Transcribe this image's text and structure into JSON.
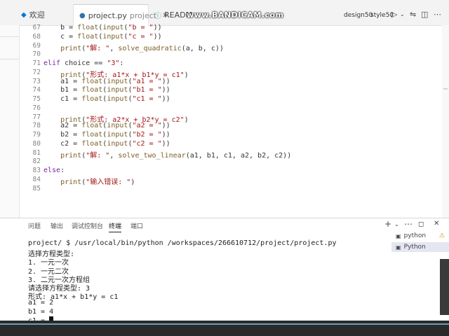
{
  "tabs": [
    {
      "label": "欢迎",
      "desc": "",
      "icon": "vscode-icon"
    },
    {
      "label": "project.py",
      "desc": "project",
      "icon": "python-file-icon"
    },
    {
      "label": "READM",
      "desc": "",
      "icon": "info-icon"
    }
  ],
  "watermark": "www.BANDICAM.com",
  "right_status": {
    "a": "design50",
    "b": "style50"
  },
  "editor": {
    "line_numbers": [
      "67",
      "68",
      "69",
      "70",
      "71",
      "72",
      "73",
      "74",
      "75",
      "76",
      "77",
      "78",
      "79",
      "80",
      "81",
      "82",
      "83",
      "84",
      "85"
    ],
    "lines": [
      "    b = float(input(\"b = \"))",
      "    c = float(input(\"c = \"))",
      "    print(\"解: \", solve_quadratic(a, b, c))",
      "",
      "elif choice == \"3\":",
      "    print(\"形式: a1*x + b1*y = c1\")",
      "    a1 = float(input(\"a1 = \"))",
      "    b1 = float(input(\"b1 = \"))",
      "    c1 = float(input(\"c1 = \"))",
      "",
      "    print(\"形式: a2*x + b2*y = c2\")",
      "    a2 = float(input(\"a2 = \"))",
      "    b2 = float(input(\"b2 = \"))",
      "    c2 = float(input(\"c2 = \"))",
      "    print(\"解: \", solve_two_linear(a1, b1, c1, a2, b2, c2))",
      "",
      "else:",
      "    print(\"输入错误: \")",
      ""
    ]
  },
  "panel_tabs": [
    "问题",
    "输出",
    "调试控制台",
    "终端",
    "端口"
  ],
  "active_panel_tab": "终端",
  "terminal": {
    "lines": [
      "project/ $ /usr/local/bin/python /workspaces/266610712/project/project.py",
      "选择方程类型:",
      "1. 一元一次",
      "2. 一元二次",
      "3. 二元一次方程组",
      "请选择方程类型: 3",
      "形式: a1*x + b1*y = c1",
      "a1 = 2",
      "b1 = 4",
      "c1 = "
    ]
  },
  "terminal_list": [
    {
      "label": "python",
      "selected": false,
      "warning": true
    },
    {
      "label": "Python",
      "selected": true,
      "warning": false
    }
  ],
  "colors": {
    "keyword": "#7b22a0",
    "string": "#a31515",
    "function": "#795e26",
    "accent": "#0078d4"
  }
}
